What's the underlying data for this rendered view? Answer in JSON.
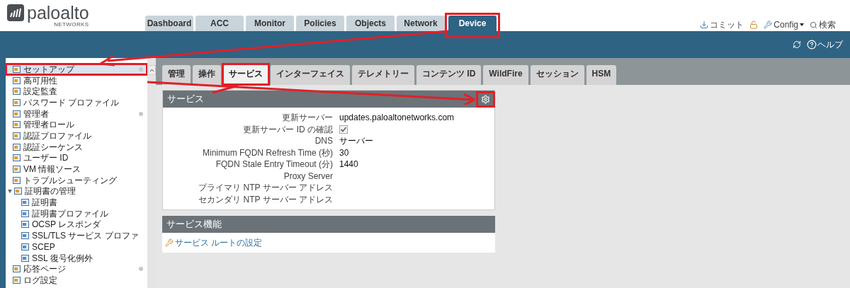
{
  "header": {
    "logo": {
      "name": "paloalto",
      "tagline": "NETWORKS"
    },
    "nav_tabs": [
      {
        "label": "Dashboard",
        "selected": false
      },
      {
        "label": "ACC",
        "selected": false
      },
      {
        "label": "Monitor",
        "selected": false
      },
      {
        "label": "Policies",
        "selected": false
      },
      {
        "label": "Objects",
        "selected": false
      },
      {
        "label": "Network",
        "selected": false
      },
      {
        "label": "Device",
        "selected": true
      }
    ],
    "actions": [
      {
        "kind": "commit",
        "label": "コミット"
      },
      {
        "kind": "lock"
      },
      {
        "kind": "config",
        "label": "Config"
      },
      {
        "kind": "search",
        "label": "検索"
      }
    ]
  },
  "toolbar": {
    "help": "ヘルプ"
  },
  "sidebar": {
    "items": [
      {
        "label": "セットアップ",
        "selected": true,
        "marked": true
      },
      {
        "label": "高可用性",
        "selected": false,
        "marked": false
      },
      {
        "label": "設定監査",
        "selected": false,
        "marked": false
      },
      {
        "label": "パスワード プロファイル",
        "selected": false,
        "marked": false
      },
      {
        "label": "管理者",
        "selected": false,
        "marked": true
      },
      {
        "label": "管理者ロール",
        "selected": false,
        "marked": false
      },
      {
        "label": "認証プロファイル",
        "selected": false,
        "marked": false
      },
      {
        "label": "認証シーケンス",
        "selected": false,
        "marked": false
      },
      {
        "label": "ユーザー ID",
        "selected": false,
        "marked": false
      },
      {
        "label": "VM 情報ソース",
        "selected": false,
        "marked": false
      },
      {
        "label": "トラブルシューティング",
        "selected": false,
        "marked": false
      },
      {
        "label": "証明書の管理",
        "selected": false,
        "marked": false,
        "expanded": true,
        "children": [
          {
            "label": "証明書",
            "selected": false,
            "marked": false
          },
          {
            "label": "証明書プロファイル",
            "selected": false,
            "marked": false
          },
          {
            "label": "OCSP レスポンダ",
            "selected": false,
            "marked": false
          },
          {
            "label": "SSL/TLS サービス プロファ",
            "selected": false,
            "marked": false
          },
          {
            "label": "SCEP",
            "selected": false,
            "marked": false
          },
          {
            "label": "SSL 復号化例外",
            "selected": false,
            "marked": false
          }
        ]
      },
      {
        "label": "応答ページ",
        "selected": false,
        "marked": true
      },
      {
        "label": "ログ設定",
        "selected": false,
        "marked": false
      }
    ]
  },
  "sub_tabs": [
    {
      "label": "管理",
      "selected": false
    },
    {
      "label": "操作",
      "selected": false
    },
    {
      "label": "サービス",
      "selected": true
    },
    {
      "label": "インターフェイス",
      "selected": false
    },
    {
      "label": "テレメトリー",
      "selected": false
    },
    {
      "label": "コンテンツ ID",
      "selected": false
    },
    {
      "label": "WildFire",
      "selected": false
    },
    {
      "label": "セッション",
      "selected": false
    },
    {
      "label": "HSM",
      "selected": false
    }
  ],
  "services_panel": {
    "title": "サービス",
    "fields": [
      {
        "kind": "text",
        "label": "更新サーバー",
        "value": "updates.paloaltonetworks.com"
      },
      {
        "kind": "checkbox",
        "label": "更新サーバー ID の確認",
        "checked": true
      },
      {
        "kind": "text",
        "label": "DNS",
        "value": "サーバー"
      },
      {
        "kind": "text",
        "label": "Minimum FQDN Refresh Time (秒)",
        "value": "30"
      },
      {
        "kind": "text",
        "label": "FQDN Stale Entry Timeout (分)",
        "value": "1440"
      },
      {
        "kind": "text",
        "label": "Proxy Server"
      },
      {
        "kind": "text",
        "label": "プライマリ NTP サーバー アドレス"
      },
      {
        "kind": "text",
        "label": "セカンダリ NTP サーバー アドレス"
      }
    ]
  },
  "features_panel": {
    "title": "サービス機能",
    "links": [
      "サービス ルートの設定"
    ]
  }
}
